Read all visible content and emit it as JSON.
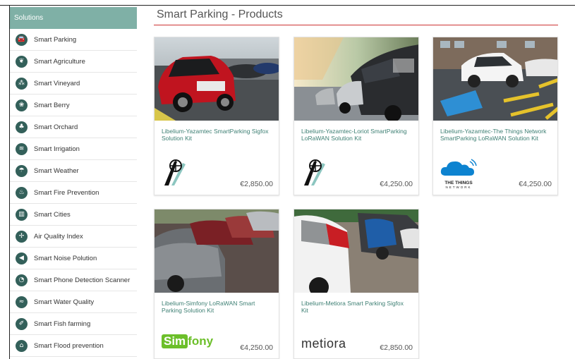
{
  "sidebar": {
    "header": "Solutions",
    "items": [
      {
        "label": "Smart Parking",
        "icon": "car-icon",
        "glyph": "🚘"
      },
      {
        "label": "Smart Agriculture",
        "icon": "leaf-icon",
        "glyph": "❦"
      },
      {
        "label": "Smart Vineyard",
        "icon": "grapes-icon",
        "glyph": "⁂"
      },
      {
        "label": "Smart Berry",
        "icon": "berry-icon",
        "glyph": "❀"
      },
      {
        "label": "Smart Orchard",
        "icon": "tree-icon",
        "glyph": "♣"
      },
      {
        "label": "Smart Irrigation",
        "icon": "irrigation-icon",
        "glyph": "≋"
      },
      {
        "label": "Smart Weather",
        "icon": "umbrella-icon",
        "glyph": "☂"
      },
      {
        "label": "Smart Fire Prevention",
        "icon": "fire-icon",
        "glyph": "♨"
      },
      {
        "label": "Smart Cities",
        "icon": "building-icon",
        "glyph": "▥"
      },
      {
        "label": "Air Quality Index",
        "icon": "fan-icon",
        "glyph": "✢"
      },
      {
        "label": "Smart Noise Polution",
        "icon": "speaker-icon",
        "glyph": "◀"
      },
      {
        "label": "Smart Phone Detection Scanner",
        "icon": "radar-icon",
        "glyph": "◔"
      },
      {
        "label": "Smart Water Quality",
        "icon": "waves-icon",
        "glyph": "≈"
      },
      {
        "label": "Smart Fish farming",
        "icon": "fish-icon",
        "glyph": "✐"
      },
      {
        "label": "Smart Flood prevention",
        "icon": "house-icon",
        "glyph": "⌂"
      }
    ]
  },
  "main": {
    "title": "Smart Parking - Products"
  },
  "products": [
    {
      "name": "Libelium-Yazamtec SmartParking Sigfox Solution Kit",
      "price": "€2,850.00",
      "logo": "yazamtec-logo"
    },
    {
      "name": "Libelium-Yazamtec-Loriot SmartParking LoRaWAN Solution Kit",
      "price": "€4,250.00",
      "logo": "yazamtec-logo"
    },
    {
      "name": "Libelium-Yazamtec-The Things Network SmartParking LoRaWAN Solution Kit",
      "price": "€4,250.00",
      "logo": "the-things-network-logo",
      "logo_text": "THE THINGS",
      "logo_sub": "NETWORK"
    },
    {
      "name": "Libelium-Simfony LoRaWAN Smart Parking Solution Kit",
      "price": "€4,250.00",
      "logo": "simfony-logo",
      "logo_a": "Sim",
      "logo_b": "fony"
    },
    {
      "name": "Libelium-Metiora Smart Parking Sigfox Kit",
      "price": "€2,850.00",
      "logo": "metiora-logo",
      "logo_text": "metiora"
    }
  ],
  "colors": {
    "sidebar_header": "#7fb0a6",
    "icon_bg": "#33605a",
    "product_name": "#3d7f73",
    "title_rule": "#cc3333"
  }
}
